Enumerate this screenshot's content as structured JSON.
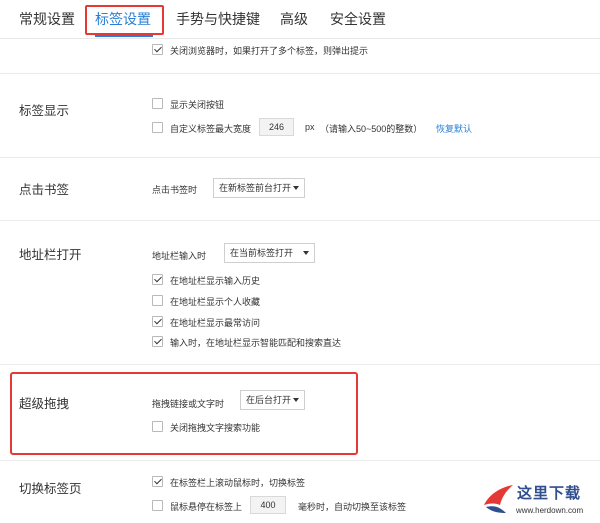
{
  "tabs": [
    {
      "label": "常规设置",
      "active": false
    },
    {
      "label": "标签设置",
      "active": true
    },
    {
      "label": "手势与快捷键",
      "active": false
    },
    {
      "label": "高级",
      "active": false
    },
    {
      "label": "安全设置",
      "active": false
    }
  ],
  "top": {
    "close_warn": {
      "label": "关闭浏览器时，如果打开了多个标签，则弹出提示",
      "checked": true
    }
  },
  "tab_display": {
    "title": "标签显示",
    "show_close": {
      "label": "显示关闭按钮",
      "checked": false
    },
    "custom_width": {
      "label": "自定义标签最大宽度",
      "checked": false
    },
    "width_value": "246",
    "width_unit": "px",
    "width_hint": "（请输入50~500的整数）",
    "restore_default": "恢复默认"
  },
  "click_bookmark": {
    "title": "点击书签",
    "label": "点击书签时",
    "selected": "在新标签前台打开"
  },
  "address_bar": {
    "title": "地址栏打开",
    "label": "地址栏输入时",
    "selected": "在当前标签打开",
    "options": [
      {
        "label": "在地址栏显示输入历史",
        "checked": true
      },
      {
        "label": "在地址栏显示个人收藏",
        "checked": false
      },
      {
        "label": "在地址栏显示最常访问",
        "checked": true
      },
      {
        "label": "输入时，在地址栏显示智能匹配和搜索直达",
        "checked": true
      }
    ]
  },
  "super_drag": {
    "title": "超级拖拽",
    "label": "拖拽链接或文字时",
    "selected": "在后台打开",
    "disable_text": {
      "label": "关闭拖拽文字搜索功能",
      "checked": false
    }
  },
  "switch_tab": {
    "title": "切换标签页",
    "wheel": {
      "label": "在标签栏上滚动鼠标时，切换标签",
      "checked": true
    },
    "hover": {
      "label": "鼠标悬停在标签上",
      "checked": false
    },
    "hover_value": "400",
    "hover_suffix": "毫秒时，自动切换至该标签"
  },
  "watermark": {
    "text": "这里下载",
    "url": "www.herdown.com"
  },
  "colors": {
    "accent": "#2a7fd5",
    "highlight": "#e53935",
    "separator": "#ececec"
  }
}
